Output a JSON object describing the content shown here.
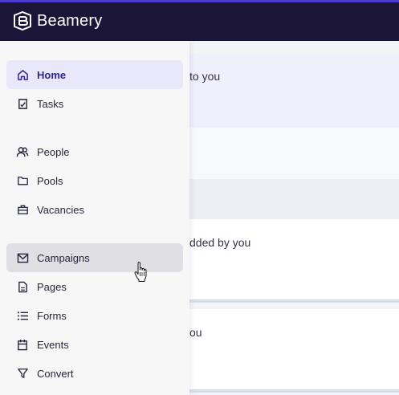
{
  "brand": {
    "name": "Beamery"
  },
  "sidebar": {
    "items": [
      {
        "label": "Home",
        "icon": "home-icon",
        "state": "active"
      },
      {
        "label": "Tasks",
        "icon": "tasks-icon"
      },
      {
        "label": "People",
        "icon": "people-icon"
      },
      {
        "label": "Pools",
        "icon": "folder-icon"
      },
      {
        "label": "Vacancies",
        "icon": "briefcase-icon"
      },
      {
        "label": "Campaigns",
        "icon": "mail-icon",
        "state": "hover"
      },
      {
        "label": "Pages",
        "icon": "page-icon"
      },
      {
        "label": "Forms",
        "icon": "list-icon"
      },
      {
        "label": "Events",
        "icon": "calendar-icon"
      },
      {
        "label": "Convert",
        "icon": "filter-icon"
      }
    ]
  },
  "main": {
    "panels": [
      {
        "text": "to you"
      },
      {
        "text": ""
      },
      {
        "text": ""
      },
      {
        "text": "dded by you"
      },
      {
        "text": "ou"
      }
    ]
  },
  "colors": {
    "topbar": "#1b1537",
    "accent": "#4b3ccf",
    "active_bg": "#e9e8fb",
    "hover_bg": "#e0e0e4"
  }
}
